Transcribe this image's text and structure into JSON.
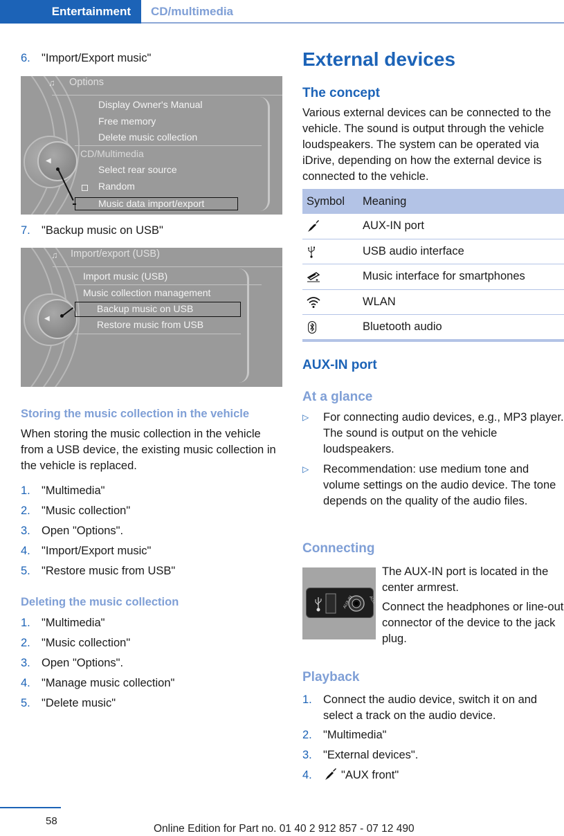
{
  "header": {
    "section": "Entertainment",
    "subsection": "CD/multimedia"
  },
  "left": {
    "step6": {
      "num": "6.",
      "text": "\"Import/Export music\""
    },
    "screen1": {
      "title": "Options",
      "items": [
        "Display Owner's Manual",
        "Free memory",
        "Delete music collection"
      ],
      "group_label": "CD/Multimedia",
      "group_items": [
        "Select rear source",
        "Random"
      ],
      "selected_item": "Music data import/export"
    },
    "step7": {
      "num": "7.",
      "text": "\"Backup music on USB\""
    },
    "screen2": {
      "title": "Import/export (USB)",
      "items": [
        "Import music (USB)",
        "Music collection management"
      ],
      "selected_item": "Backup music on USB",
      "after_items": [
        "Restore music from USB"
      ]
    },
    "storing": {
      "heading": "Storing the music collection in the vehicle",
      "body": "When storing the music collection in the vehicle from a USB device, the existing music collection in the vehicle is replaced.",
      "steps": [
        {
          "num": "1.",
          "text": "\"Multimedia\""
        },
        {
          "num": "2.",
          "text": "\"Music collection\""
        },
        {
          "num": "3.",
          "text": "Open \"Options\"."
        },
        {
          "num": "4.",
          "text": "\"Import/Export music\""
        },
        {
          "num": "5.",
          "text": "\"Restore music from USB\""
        }
      ]
    },
    "deleting": {
      "heading": "Deleting the music collection",
      "steps": [
        {
          "num": "1.",
          "text": "\"Multimedia\""
        },
        {
          "num": "2.",
          "text": "\"Music collection\""
        },
        {
          "num": "3.",
          "text": "Open \"Options\"."
        },
        {
          "num": "4.",
          "text": "\"Manage music collection\""
        },
        {
          "num": "5.",
          "text": "\"Delete music\""
        }
      ]
    }
  },
  "right": {
    "title": "External devices",
    "concept": {
      "heading": "The concept",
      "body": "Various external devices can be connected to the vehicle. The sound is output through the vehicle loudspeakers. The system can be operated via iDrive, depending on how the external device is connected to the vehicle."
    },
    "table": {
      "headers": [
        "Symbol",
        "Meaning"
      ],
      "rows": [
        {
          "icon": "aux-plug-icon",
          "meaning": "AUX-IN port"
        },
        {
          "icon": "usb-icon",
          "meaning": "USB audio interface"
        },
        {
          "icon": "smartphone-interface-icon",
          "meaning": "Music interface for smartphones"
        },
        {
          "icon": "wlan-icon",
          "meaning": "WLAN"
        },
        {
          "icon": "bluetooth-icon",
          "meaning": "Bluetooth audio"
        }
      ]
    },
    "aux": {
      "heading": "AUX-IN port",
      "glance_heading": "At a glance",
      "bullets": [
        "For connecting audio devices, e.g., MP3 player. The sound is output on the vehicle loudspeakers.",
        "Recommendation: use medium tone and volume settings on the audio device. The tone depends on the quality of the audio files."
      ],
      "connecting_heading": "Connecting",
      "connecting_p1": "The AUX-IN port is located in the center armrest.",
      "connecting_p2": "Connect the headphones or line-out connector of the device to the jack plug.",
      "port_label": "AUX-IN",
      "playback_heading": "Playback",
      "playback_steps": [
        {
          "num": "1.",
          "text": "Connect the audio device, switch it on and select a track on the audio device."
        },
        {
          "num": "2.",
          "text": "\"Multimedia\""
        },
        {
          "num": "3.",
          "text": "\"External devices\"."
        },
        {
          "num": "4.",
          "text": "\"AUX front\"",
          "icon": "aux-plug-icon"
        }
      ]
    }
  },
  "footer": {
    "page_number": "58",
    "edition": "Online Edition for Part no. 01 40 2 912 857 - 07 12 490"
  },
  "colors": {
    "brand_blue": "#1c63b7",
    "sub_heading": "#7f9fd6",
    "table_header": "#b3c3e6"
  }
}
